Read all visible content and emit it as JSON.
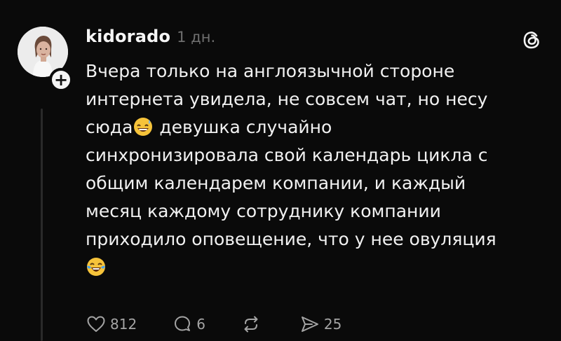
{
  "post": {
    "username": "kidorado",
    "time": "1 дн.",
    "text_lines": [
      "Вчера только на англоязычной стороне",
      "интернета увидела, не совсем чат, но несу",
      "сюда",
      " девушка случайно",
      "синхронизировала свой календарь цикла с",
      "общим календарем компании, и каждый",
      "месяц каждому сотруднику компании",
      "приходило оповещение, что у нее овуляция"
    ],
    "emojis": [
      "grinning-sweat-emoji",
      "tears-of-joy-emoji"
    ]
  },
  "actions": {
    "likes": "812",
    "comments": "6",
    "shares": "25"
  },
  "colors": {
    "background": "#0a0a0a",
    "text": "#f1f1f1",
    "muted": "#a4a4a4",
    "time": "#6f6f6f"
  },
  "icons": [
    "threads-logo-icon",
    "plus-icon",
    "heart-icon",
    "comment-icon",
    "repost-icon",
    "send-icon"
  ]
}
